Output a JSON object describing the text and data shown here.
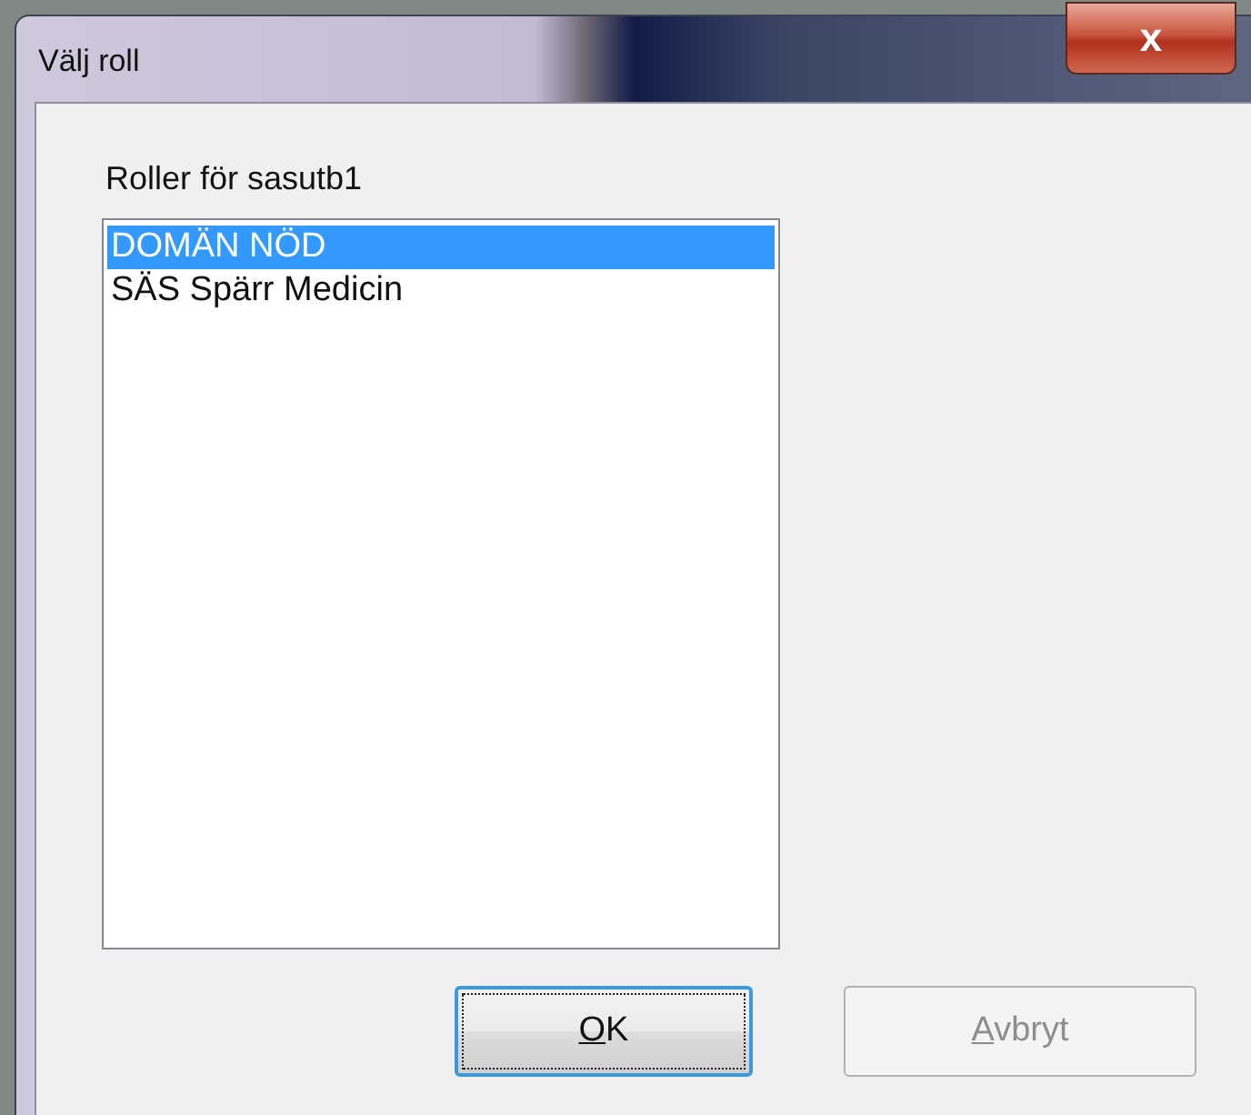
{
  "window": {
    "title": "Välj roll",
    "close": "x"
  },
  "label": "Roller för sasutb1",
  "roles": [
    {
      "name": "DOMÄN NÖD",
      "selected": true
    },
    {
      "name": "SÄS Spärr Medicin",
      "selected": false
    }
  ],
  "buttons": [
    {
      "label": "OK",
      "default": true,
      "disabled": false
    },
    {
      "label": "Avbryt",
      "default": false,
      "disabled": true
    }
  ]
}
